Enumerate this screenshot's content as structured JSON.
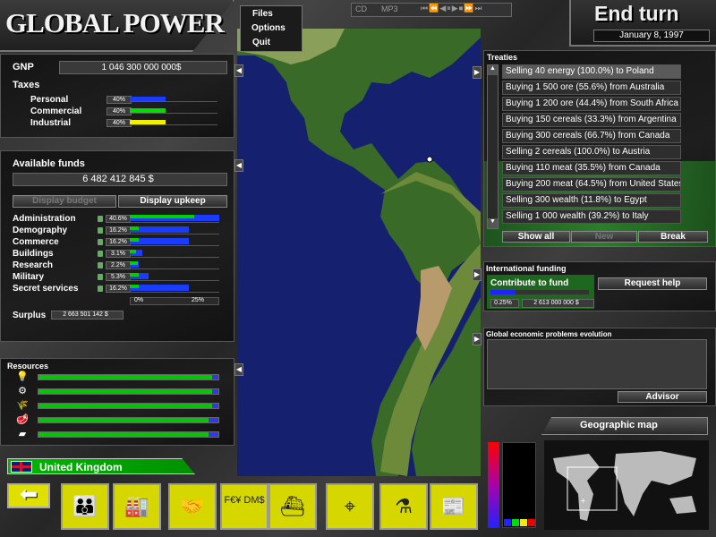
{
  "app": {
    "logo": "GLOBAL POWER"
  },
  "menu": {
    "files": "Files",
    "options": "Options",
    "quit": "Quit"
  },
  "player": {
    "cd": "CD",
    "mp3": "MP3",
    "controls": [
      "⏮",
      "⏪",
      "◀",
      "⏸",
      "▶",
      "⏹",
      "⏩",
      "⏭"
    ]
  },
  "turn": {
    "end_label": "End turn",
    "date": "January 8, 1997"
  },
  "economy": {
    "gnp_label": "GNP",
    "gnp_value": "1 046 300 000 000$",
    "taxes_label": "Taxes",
    "taxes": [
      {
        "label": "Personal",
        "pct": "40%",
        "level": 0.4,
        "color": "#1a3cff"
      },
      {
        "label": "Commercial",
        "pct": "40%",
        "level": 0.4,
        "color": "#00e000"
      },
      {
        "label": "Industrial",
        "pct": "40%",
        "level": 0.4,
        "color": "#f0f000"
      }
    ]
  },
  "funds": {
    "label": "Available funds",
    "value": "6 482 412 845 $",
    "display_budget": "Display budget",
    "display_upkeep": "Display upkeep",
    "items": [
      {
        "label": "Administration",
        "pct": "40.6%",
        "green": 0.72,
        "blue": 1.0
      },
      {
        "label": "Demography",
        "pct": "16.2%",
        "green": 0.1,
        "blue": 0.66
      },
      {
        "label": "Commerce",
        "pct": "16.2%",
        "green": 0.1,
        "blue": 0.66
      },
      {
        "label": "Buildings",
        "pct": "3.1%",
        "green": 0.07,
        "blue": 0.14
      },
      {
        "label": "Research",
        "pct": "2.2%",
        "green": 0.09,
        "blue": 0.1
      },
      {
        "label": "Military",
        "pct": "5.3%",
        "green": 0.1,
        "blue": 0.21
      },
      {
        "label": "Secret services",
        "pct": "16.2%",
        "green": 0.1,
        "blue": 0.66
      }
    ],
    "slider_left": "0%",
    "slider_right": "25%",
    "surplus_label": "Surplus",
    "surplus_value": "2 663 501 142 $"
  },
  "resources": {
    "label": "Resources",
    "items": [
      {
        "icon": "lightbulb-icon",
        "glyph": "💡",
        "level": 0.98
      },
      {
        "icon": "ore-icon",
        "glyph": "⚙",
        "level": 0.98
      },
      {
        "icon": "cereals-icon",
        "glyph": "🌾",
        "level": 0.98
      },
      {
        "icon": "meat-icon",
        "glyph": "🥩",
        "level": 0.96
      },
      {
        "icon": "gold-icon",
        "glyph": "▰",
        "level": 0.96
      }
    ]
  },
  "country": {
    "name": "United Kingdom"
  },
  "treaties": {
    "label": "Treaties",
    "items": [
      "Selling 40 energy (100.0%) to Poland",
      "Buying 1 500 ore (55.6%) from Australia",
      "Buying 1 200 ore (44.4%) from South Africa",
      "Buying 150 cereals (33.3%) from Argentina",
      "Buying 300 cereals (66.7%) from Canada",
      "Selling 2 cereals (100.0%) to Austria",
      "Buying 110 meat (35.5%) from Canada",
      "Buying 200 meat (64.5%) from United States",
      "Selling 300 wealth (11.8%) to Egypt",
      "Selling 1 000 wealth (39.2%) to Italy"
    ],
    "show_all": "Show all",
    "new": "New",
    "break": "Break"
  },
  "intl": {
    "label": "International funding",
    "contribute": "Contribute to fund",
    "request": "Request help",
    "pct": "0.25%",
    "amount": "2 613 000 000 $",
    "level": 0.25
  },
  "global": {
    "label": "Global economic problems evolution",
    "advisor": "Advisor"
  },
  "geo": {
    "label": "Geographic map"
  },
  "toolbar": {
    "items": [
      {
        "name": "population-button",
        "glyph": "👪"
      },
      {
        "name": "industry-button",
        "glyph": "🏭"
      },
      {
        "name": "trade-button",
        "glyph": "🤝"
      },
      {
        "name": "finance-button",
        "glyph": "F€¥ DM$"
      },
      {
        "name": "military-button",
        "glyph": "⛴"
      },
      {
        "name": "espionage-button",
        "glyph": "⌖"
      },
      {
        "name": "research-button",
        "glyph": "⚗"
      },
      {
        "name": "news-button",
        "glyph": "📰"
      }
    ]
  }
}
